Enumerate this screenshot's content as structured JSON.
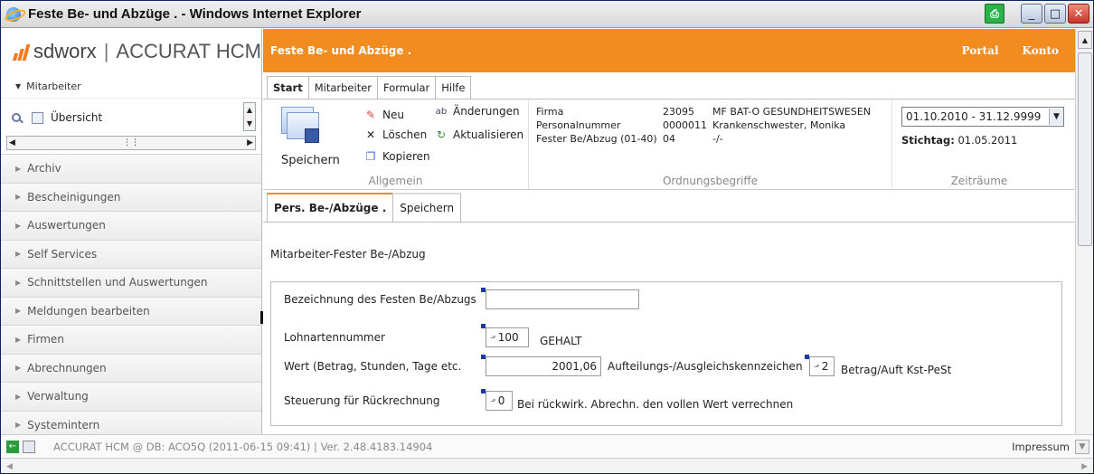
{
  "window": {
    "title": "Feste Be- und Abzüge . - Windows Internet Explorer"
  },
  "brand": {
    "company": "sdworx",
    "separator": "|",
    "product": "ACCURAT HCM",
    "accent": "#f28c1e"
  },
  "nav": {
    "section": "Mitarbeiter",
    "overview": "Übersicht",
    "items": [
      {
        "label": "Archiv"
      },
      {
        "label": "Bescheinigungen"
      },
      {
        "label": "Auswertungen"
      },
      {
        "label": "Self Services"
      },
      {
        "label": "Schnittstellen und Auswertungen"
      },
      {
        "label": "Meldungen bearbeiten"
      },
      {
        "label": "Firmen"
      },
      {
        "label": "Abrechnungen"
      },
      {
        "label": "Verwaltung"
      },
      {
        "label": "Systemintern"
      }
    ]
  },
  "header": {
    "title": "Feste Be- und Abzüge .",
    "links": [
      "Portal",
      "Konto"
    ]
  },
  "tabs": [
    "Start",
    "Mitarbeiter",
    "Formular",
    "Hilfe"
  ],
  "ribbon": {
    "allgemein": {
      "label": "Allgemein",
      "save": "Speichern",
      "neu": "Neu",
      "loeschen": "Löschen",
      "kopieren": "Kopieren",
      "aenderungen": "Änderungen",
      "aktualisieren": "Aktualisieren"
    },
    "ordnung": {
      "label": "Ordnungsbegriffe",
      "rows": [
        {
          "k": "Firma",
          "v": "23095",
          "d": "MF BAT-O GESUNDHEITSWESEN"
        },
        {
          "k": "Personalnummer",
          "v": "0000011",
          "d": "Krankenschwester, Monika"
        },
        {
          "k": "Fester Be/Abzug (01-40)",
          "v": "04",
          "d": "-/-"
        }
      ]
    },
    "zeit": {
      "label": "Zeiträume",
      "range": "01.10.2010 - 31.12.9999",
      "stichtag_label": "Stichtag:",
      "stichtag": "01.05.2011"
    }
  },
  "subtabs": [
    "Pers. Be-/Abzüge .",
    "Speichern"
  ],
  "form": {
    "title": "Mitarbeiter-Fester Be-/Abzug",
    "bezeichnung_label": "Bezeichnung des Festen Be/Abzugs",
    "bezeichnung_value": "",
    "lohnart_label": "Lohnartennummer",
    "lohnart_value": "100",
    "lohnart_desc": "GEHALT",
    "wert_label": "Wert (Betrag, Stunden, Tage etc.",
    "wert_value": "2001,06",
    "aufteil_label": "Aufteilungs-/Ausgleichskennzeichen",
    "aufteil_value": "2",
    "aufteil_desc": "Betrag/Auft Kst-PeSt",
    "steuer_label": "Steuerung für Rückrechnung",
    "steuer_value": "0",
    "steuer_desc": "Bei rückwirk. Abrechn. den vollen Wert verrechnen"
  },
  "status": {
    "text": "ACCURAT HCM @ DB: ACO5Q (2011-06-15 09:41) | Ver. 2.48.4183.14904",
    "impressum": "Impressum"
  }
}
